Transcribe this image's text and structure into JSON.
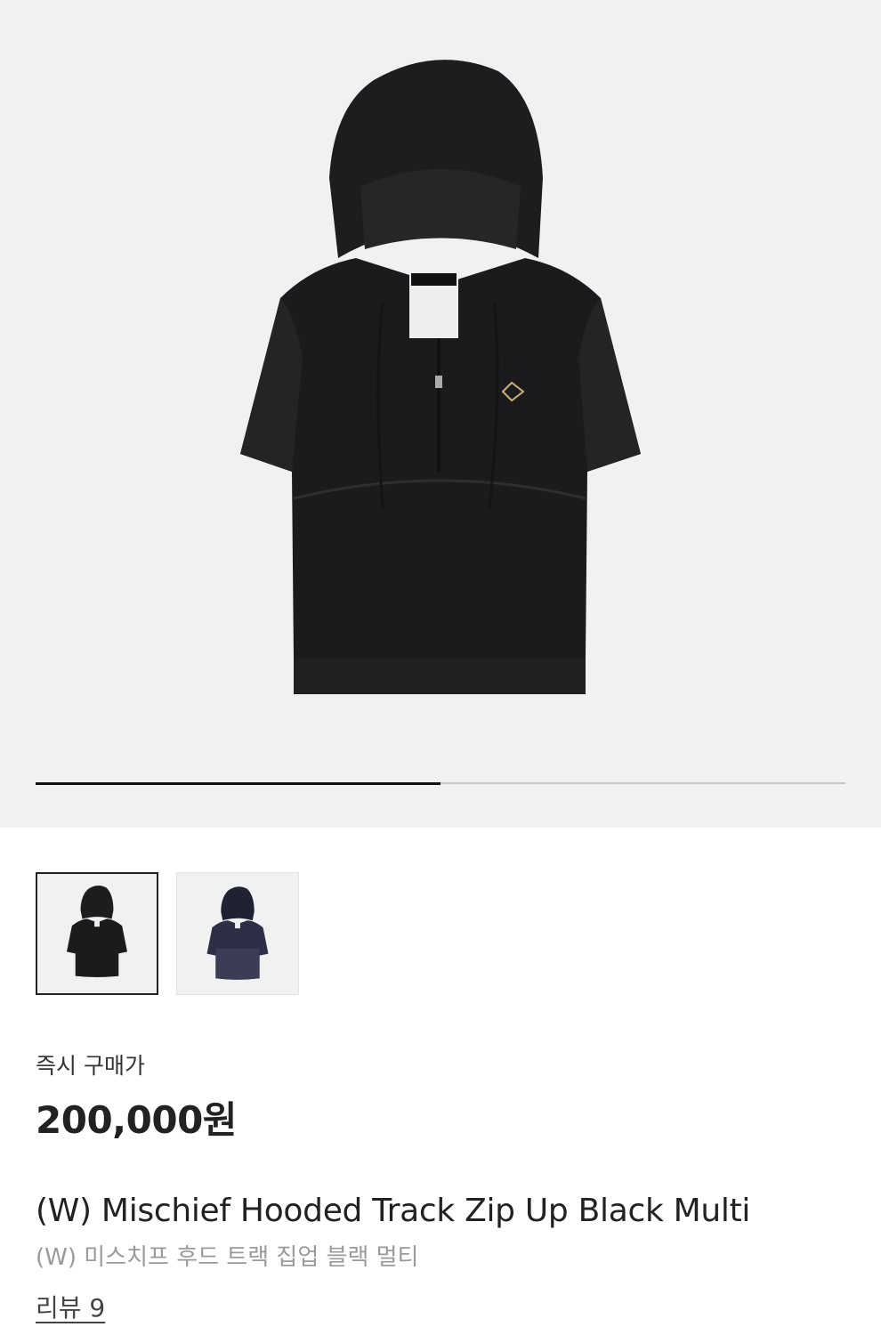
{
  "gallery": {
    "main_image": "black-hooded-track-zip-up-photo",
    "current_slide": 1,
    "total_slides": 2,
    "progress": 0.5,
    "colors": {
      "background": "#f1f1f1",
      "garment": "#1b1b1d",
      "track": "#c9c9c9",
      "fill": "#111111"
    }
  },
  "thumbnails": [
    {
      "name": "black-variant",
      "selected": true
    },
    {
      "name": "navy-variant",
      "selected": false
    }
  ],
  "pricing": {
    "label": "즉시 구매가",
    "price": "200,000원"
  },
  "product": {
    "title_en": "(W) Mischief Hooded Track Zip Up Black Multi",
    "title_ko": "(W) 미스치프 후드 트랙 집업 블랙 멀티",
    "review_link": "리뷰 9"
  }
}
